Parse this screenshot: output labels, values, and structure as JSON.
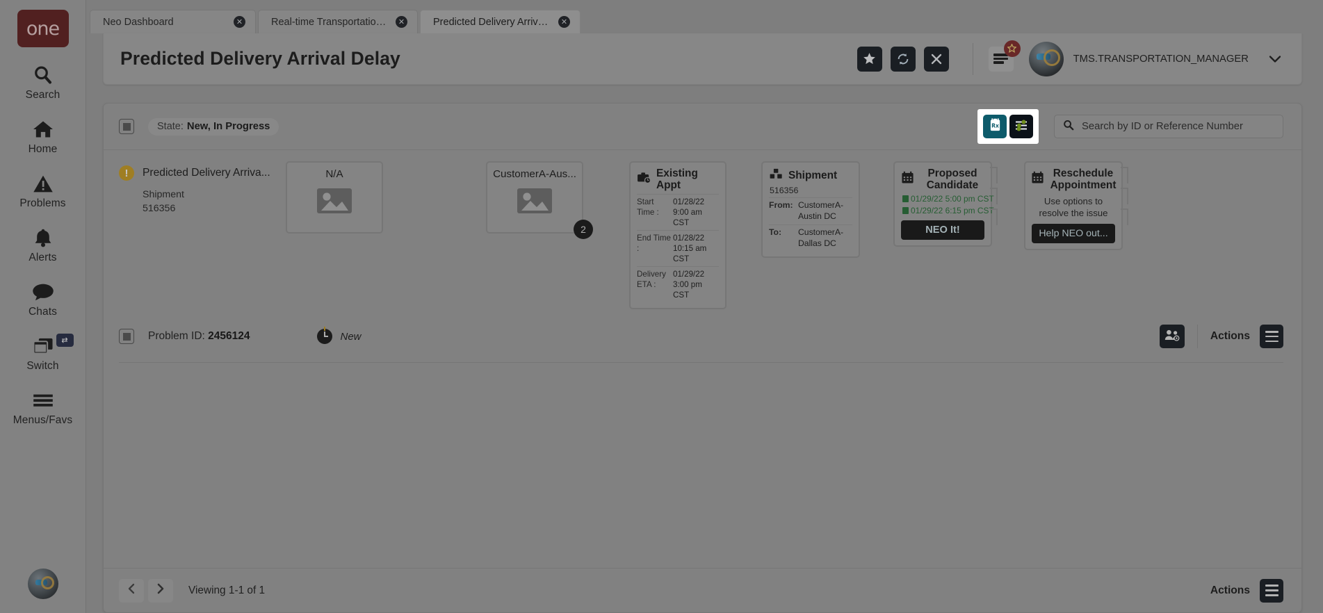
{
  "sidebar": {
    "logo_text": "one",
    "items": [
      {
        "label": "Search",
        "icon": "search-icon"
      },
      {
        "label": "Home",
        "icon": "home-icon"
      },
      {
        "label": "Problems",
        "icon": "warning-triangle-icon"
      },
      {
        "label": "Alerts",
        "icon": "bell-icon"
      },
      {
        "label": "Chats",
        "icon": "chat-bubble-icon"
      },
      {
        "label": "Switch",
        "icon": "windows-stack-icon",
        "badge_icon": "swap-arrows-icon"
      },
      {
        "label": "Menus/Favs",
        "icon": "hamburger-icon"
      }
    ],
    "bottom_avatar": "neo-bot-avatar"
  },
  "tabs": [
    {
      "label": "Neo Dashboard",
      "active": false,
      "closable": true
    },
    {
      "label": "Real-time Transportation Executi...",
      "active": false,
      "closable": true
    },
    {
      "label": "Predicted Delivery Arrival Delay",
      "active": true,
      "closable": true
    }
  ],
  "header": {
    "title": "Predicted Delivery Arrival Delay",
    "buttons": [
      {
        "name": "favorite-button",
        "icon": "star-icon"
      },
      {
        "name": "refresh-button",
        "icon": "refresh-icon"
      },
      {
        "name": "close-button",
        "icon": "x-icon"
      }
    ],
    "menu_badge_icon": "star-icon",
    "user_name": "TMS.TRANSPORTATION_MANAGER",
    "caret_icon": "chevron-down-icon"
  },
  "filter_bar": {
    "state_label": "State:",
    "state_value": "New, In Progress",
    "doc_button_icon": "clipboard-rx-icon",
    "doc_button_color": "#0d5b6b",
    "filter_button_icon": "sliders-icon",
    "search_placeholder": "Search by ID or Reference Number",
    "search_value": "",
    "search_icon": "search-icon"
  },
  "problem": {
    "warn_icon": "exclamation-circle-icon",
    "title": "Predicted Delivery Arriva...",
    "sub_label": "Shipment",
    "sub_value": "516356",
    "thumbs": [
      {
        "caption": "N/A",
        "badge": ""
      },
      {
        "caption": "CustomerA-Aus...",
        "badge": "2"
      }
    ],
    "existing_appt": {
      "icon": "appointment-briefcase-clock-icon",
      "title": "Existing Appt",
      "rows": [
        {
          "key": "Start Time :",
          "value": "01/28/22 9:00 am CST"
        },
        {
          "key": "End Time :",
          "value": "01/28/22 10:15 am CST"
        },
        {
          "key": "Delivery ETA :",
          "value": "01/29/22 3:00 pm CST"
        }
      ]
    },
    "shipment": {
      "icon": "boxes-icon",
      "title": "Shipment",
      "number": "516356",
      "rows": [
        {
          "key": "From:",
          "value": "CustomerA-Austin DC"
        },
        {
          "key": "To:",
          "value": "CustomerA-Dallas DC"
        }
      ]
    },
    "proposed_candidate": {
      "icon": "calendar-icon",
      "title": "Proposed Candidate",
      "date_1": "01/29/22 5:00 pm CST",
      "date_2": "01/29/22 6:15 pm CST",
      "date_color": "#1c6b2e",
      "button_label": "NEO It!"
    },
    "reschedule": {
      "icon": "calendar-icon",
      "title": "Reschedule Appointment",
      "note": "Use options to resolve the issue",
      "button_label": "Help NEO out..."
    },
    "id_label": "Problem ID:",
    "id_value": "2456124",
    "status_icon": "clock-icon",
    "status_text": "New",
    "people_button_icon": "people-gear-icon",
    "actions_label": "Actions",
    "actions_icon": "hamburger-icon"
  },
  "footer": {
    "prev_icon": "chevron-left-icon",
    "next_icon": "chevron-right-icon",
    "viewing_text": "Viewing 1-1 of 1",
    "actions_label": "Actions",
    "actions_icon": "hamburger-icon"
  }
}
